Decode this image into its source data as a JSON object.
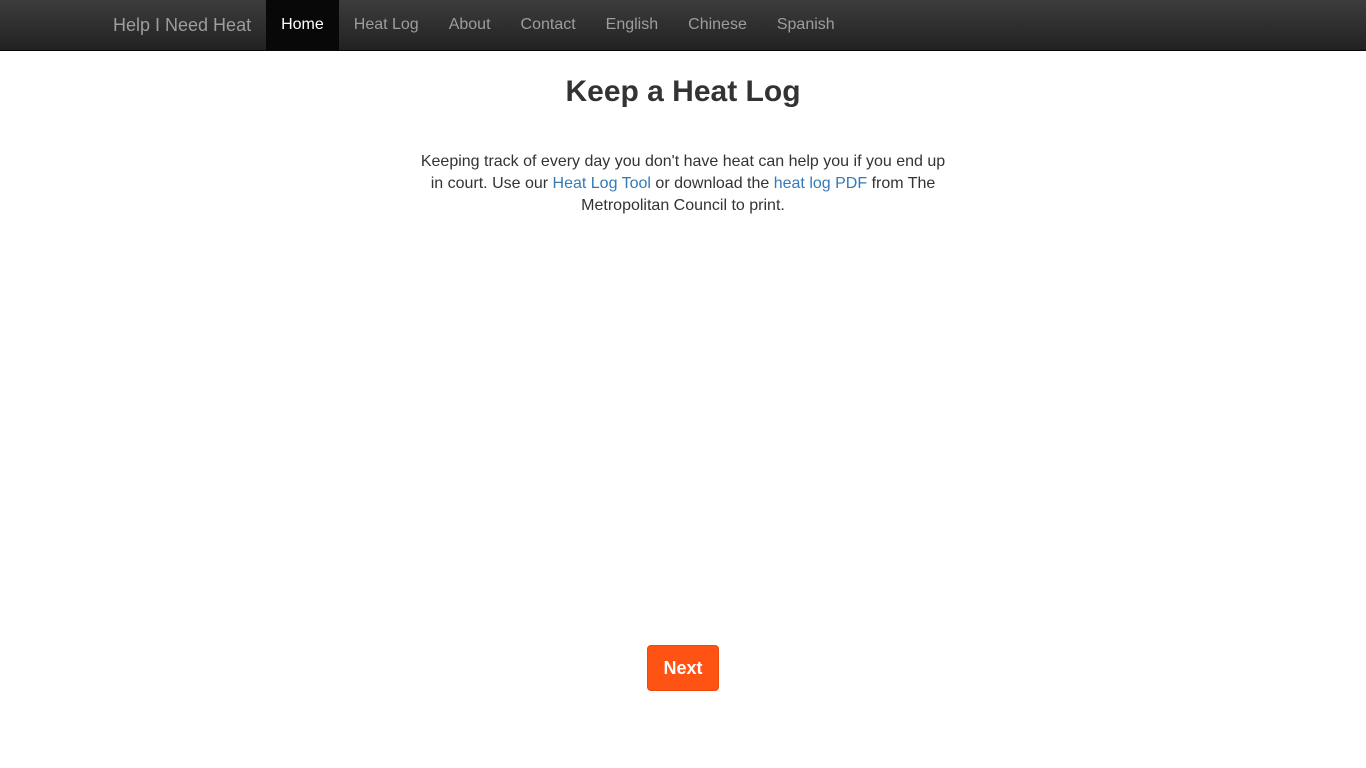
{
  "nav": {
    "brand": "Help I Need Heat",
    "items": [
      {
        "label": "Home",
        "active": true
      },
      {
        "label": "Heat Log",
        "active": false
      },
      {
        "label": "About",
        "active": false
      },
      {
        "label": "Contact",
        "active": false
      },
      {
        "label": "English",
        "active": false
      },
      {
        "label": "Chinese",
        "active": false
      },
      {
        "label": "Spanish",
        "active": false
      }
    ]
  },
  "main": {
    "title": "Keep a Heat Log",
    "intro": {
      "part1": "Keeping track of every day you don't have heat can help you if you end up in court. Use our ",
      "link1": "Heat Log Tool",
      "part2": " or download the ",
      "link2": "heat log PDF",
      "part3": " from The Metropolitan Council to print."
    },
    "next_label": "Next"
  },
  "colors": {
    "navbar_top": "#3c3c3c",
    "navbar_bottom": "#222222",
    "active_nav_bg": "#080808",
    "link": "#337ab7",
    "next_button": "#ff5314"
  }
}
